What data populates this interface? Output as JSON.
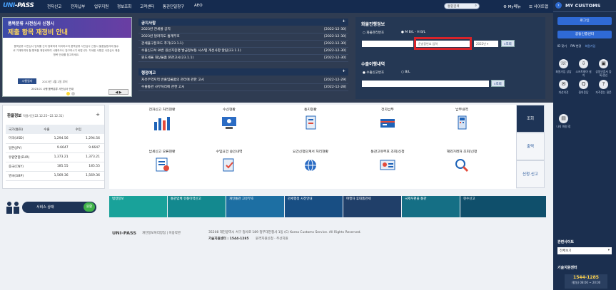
{
  "header": {
    "logo_uni": "UNI",
    "logo_pass": "-PASS",
    "nav": [
      "전자신고",
      "전자납부",
      "업무지원",
      "정보조회",
      "고객센터",
      "통관단일창구",
      "AEO"
    ],
    "search_placeholder": "통합검색",
    "my_menu": "My메뉴",
    "sitemap": "사이트맵"
  },
  "sidebar": {
    "title": "MY CUSTOMS",
    "login": "로그인",
    "cert_center": "공동인증센터",
    "links": [
      "ID 찾기",
      "PW 변경",
      "회원가입"
    ],
    "icons": [
      {
        "label": "회원가입 상담",
        "icon": "phone-icon"
      },
      {
        "label": "소프트웨어 설치",
        "icon": "download-icon"
      },
      {
        "label": "공동인증서 등록/갱신",
        "icon": "certificate-icon"
      },
      {
        "label": "개선의견",
        "icon": "chat-icon"
      },
      {
        "label": "질의응답",
        "icon": "qa-icon"
      },
      {
        "label": "자주묻는 질문",
        "icon": "faq-icon"
      },
      {
        "label": "나의 화원 정",
        "icon": "doc-icon"
      }
    ],
    "related_title": "관련사이트",
    "related_select": "전체보기",
    "callcenter_title": "기술지원센터",
    "callcenter_tel": "1544-1285",
    "callcenter_hours": "(평일) 08:00 ~ 20:00"
  },
  "banner": {
    "line1": "품목분류 사전심사 신청시",
    "line2": "제출 항목 재정비 안내",
    "body": "품목분류 사전심사 업무를 신속·정확하게 처리하고자 품목분류 사전심사 신청시 물품설명서에 필수로 기재하여야 할 항목을 재정비하여 시행하오니 참고하시기 바랍니다. 자세한 사항은 사전심사 제출항목 안내를 참고하세요.",
    "button": "시행일자",
    "date": "2023년 1월 2일 부터",
    "caption": "2023.01 시행 품목분류 사전심사 안내",
    "controls": "◀ ▶"
  },
  "notices": {
    "title": "공지사항",
    "items": [
      {
        "text": "2023년 관세율 공지",
        "date": "[2022-12-30]"
      },
      {
        "text": "2023년 달러지도 통계부호",
        "date": "[2022-12-30]"
      },
      {
        "text": "관세율구분코드 추가(23.1.1)",
        "date": "[2022-12-30]"
      },
      {
        "text": "수출신고서 8I번 원산지증명 발급정보등 시스템 개선사항 알림(23.1.1)",
        "date": "[2022-12-30]"
      },
      {
        "text": "원도세율 대상물품 본관고시(23.1.1)",
        "date": "[2022-12-30]"
      }
    ]
  },
  "admin": {
    "title": "행정예고",
    "items": [
      {
        "text": "자유무역지역 반출입물품의 관리에 관한 고시",
        "date": "[2022-12-29]"
      },
      {
        "text": "수출통관 사무처리에 관한 고시",
        "date": "[2022-12-28]"
      }
    ]
  },
  "cargo": {
    "title": "화물진행정보",
    "radio1": "화물관리번호",
    "radio2": "M B/L - H B/L",
    "bl_placeholder": "",
    "hbl_placeholder": "운송장번호 입력",
    "year": "2022년",
    "search": "조회",
    "export_title": "수출이행내역",
    "export_radio1": "수출신고번호",
    "export_radio2": "B/L",
    "export_search": "조회"
  },
  "exchange": {
    "title": "환율정보",
    "period": "적용기간(22.12.25~22.12.31)",
    "headers": [
      "국가(통화)",
      "수출",
      "수입"
    ],
    "rows": [
      [
        "미국(USD)",
        "1,294.56",
        "1,294.56"
      ],
      [
        "일본(JPY)",
        "9.6647",
        "9.6647"
      ],
      [
        "유럽연합(EUR)",
        "1,373.21",
        "1,373.21"
      ],
      [
        "중국(CNY)",
        "185.55",
        "185.55"
      ],
      [
        "영국(GBP)",
        "1,569.36",
        "1,569.36"
      ]
    ]
  },
  "services": {
    "row1": [
      "전자신고 처리현황",
      "수신현황",
      "통지현황",
      "전자납부",
      "납부내역"
    ],
    "row2": [
      "납세신고 오류현황",
      "수입요건 승인내역",
      "요건신청단계서 처리현황",
      "통관고유부호 조회/신청",
      "해외거래처 조회/신청"
    ],
    "tabs": [
      "조회",
      "출력",
      "신청·신고"
    ]
  },
  "service_status": {
    "label": "서비스 상태",
    "state": "원활"
  },
  "strip": [
    {
      "label": "법령정보",
      "color": "#19a29a"
    },
    {
      "label": "통관업체 유통이력신고",
      "color": "#13898f"
    },
    {
      "label": "개인통관 고유부호",
      "color": "#1d6fa3"
    },
    {
      "label": "관세행정 사전안내",
      "color": "#184e83"
    },
    {
      "label": "여행자 휴대품관세",
      "color": "#203f69"
    },
    {
      "label": "국제우편물 통관",
      "color": "#156f85"
    },
    {
      "label": "현수신고",
      "color": "#0f4f6b"
    }
  ],
  "footer": {
    "logo": "UNI-PASS",
    "links": "개인정보처리방침 | 이용약관",
    "address": "35208 대전광역시 서구 청사로 189 정부대전청사 1동 (C) Korea Customs Service. All Rights Reserved.",
    "callcenter": "기술지원센터 : 1544-1285",
    "links2": "원격지원신청 · 주선지원"
  }
}
